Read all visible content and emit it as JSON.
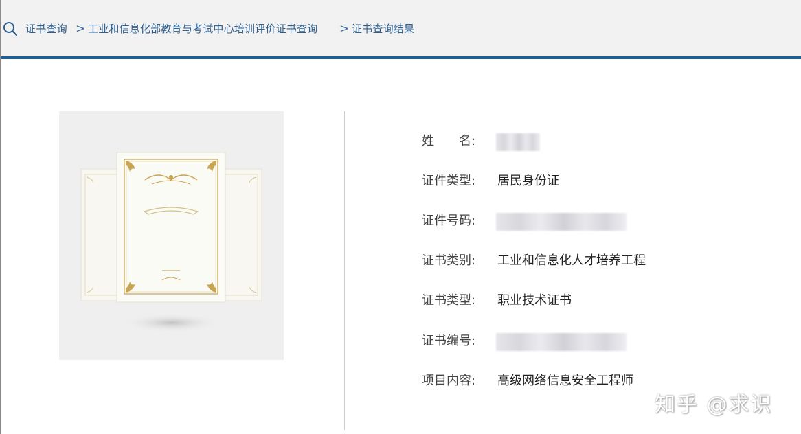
{
  "breadcrumb": {
    "items": [
      "证书查询",
      "工业和信息化部教育与考试中心培训评价证书查询",
      "证书查询结果"
    ],
    "separator": ">"
  },
  "details": {
    "name_label": "姓　　名:",
    "id_type_label": "证件类型:",
    "id_type_value": "居民身份证",
    "id_number_label": "证件号码:",
    "cert_category_label": "证书类别:",
    "cert_category_value": "工业和信息化人才培养工程",
    "cert_type_label": "证书类型:",
    "cert_type_value": "职业技术证书",
    "cert_number_label": "证书编号:",
    "project_label": "项目内容:",
    "project_value": "高级网络信息安全工程师"
  },
  "watermark": "知乎 @求识",
  "colors": {
    "accent": "#1d5e94",
    "link": "#2c5f8f",
    "gold": "#c9a452"
  }
}
